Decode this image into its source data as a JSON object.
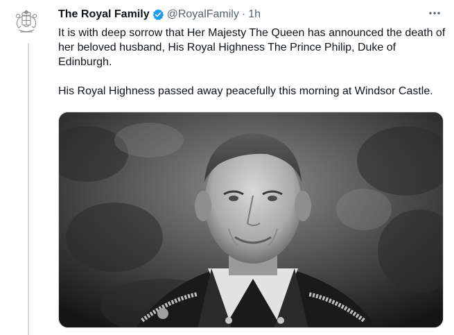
{
  "tweet": {
    "display_name": "The Royal Family",
    "handle": "@RoyalFamily",
    "separator": "·",
    "time": "1h",
    "paragraph_1": "It is with deep sorrow that Her Majesty The Queen has announced the death of her beloved husband, His Royal Highness The Prince Philip, Duke of Edinburgh.",
    "paragraph_2": "His Royal Highness passed away peacefully this morning at Windsor Castle."
  },
  "icons": {
    "avatar": "royal-coat-of-arms",
    "verified": "verified-badge-icon",
    "more": "more-icon"
  },
  "colors": {
    "verified": "#1d9bf0",
    "secondary_text": "#536471",
    "thread_line": "#cfd9de"
  }
}
